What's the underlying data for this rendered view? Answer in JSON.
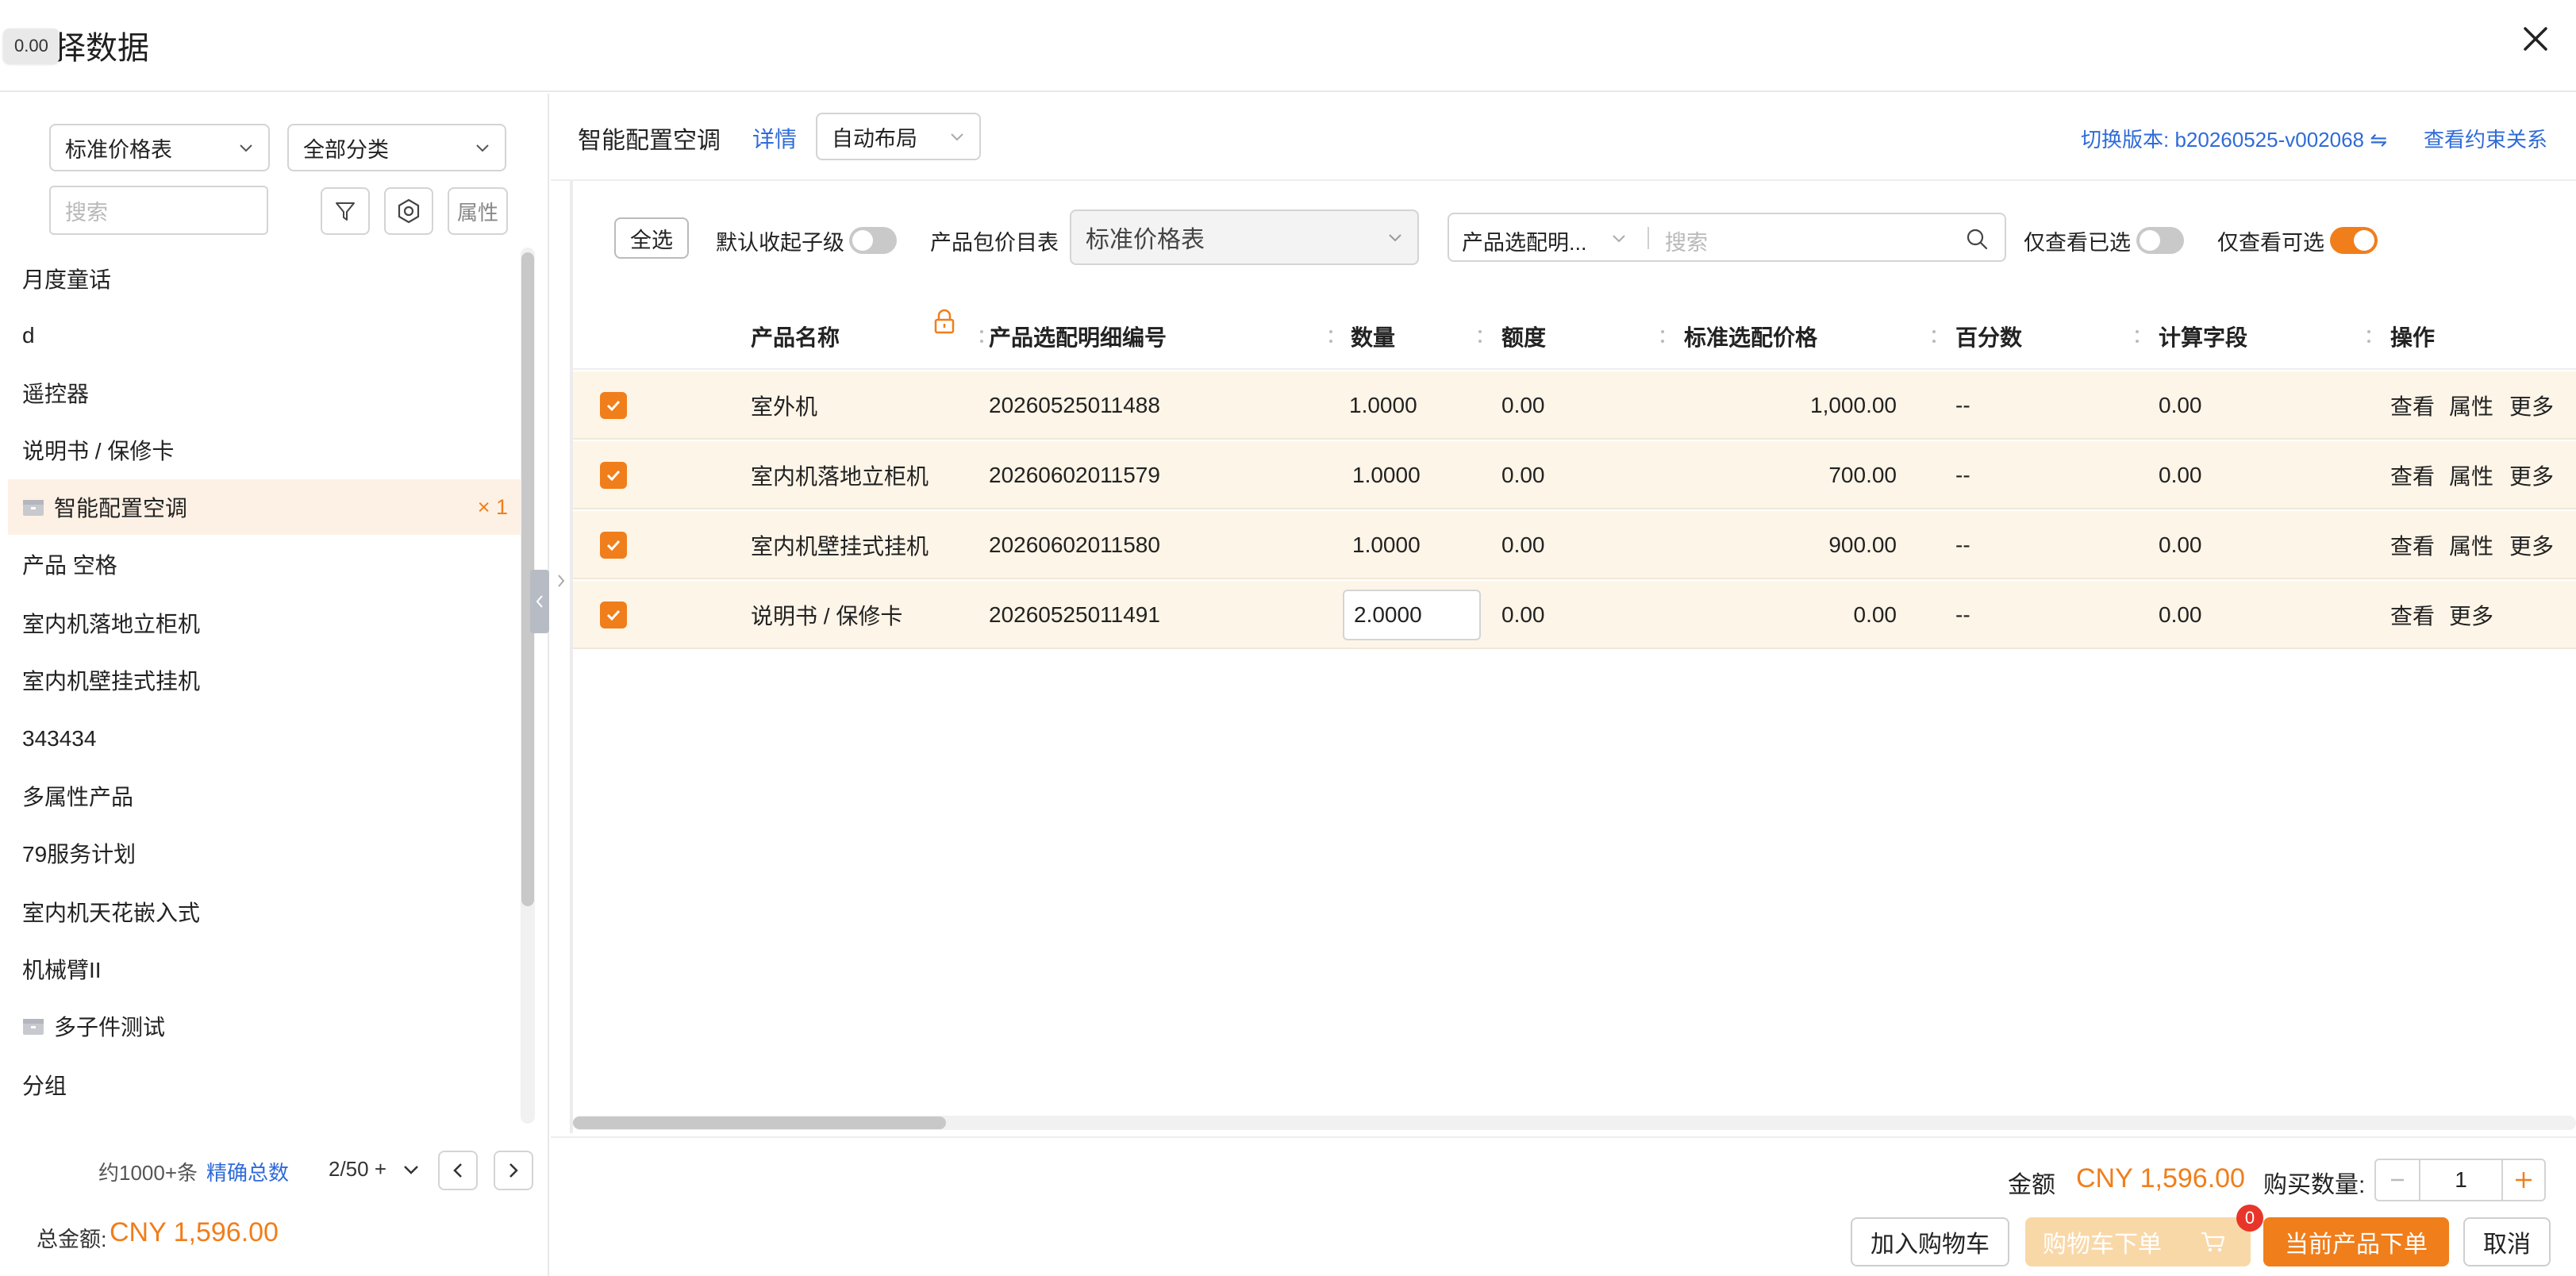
{
  "dialog": {
    "title": "选择数据",
    "tooltip": "0.00"
  },
  "left": {
    "price_list_select": "标准价格表",
    "category_select": "全部分类",
    "search_placeholder": "搜索",
    "attr_button": "属性",
    "items": [
      {
        "label": "月度童话"
      },
      {
        "label": "d"
      },
      {
        "label": "遥控器"
      },
      {
        "label": "说明书 / 保修卡"
      },
      {
        "label": "智能配置空调",
        "count": "× 1"
      },
      {
        "label": "产品 空格"
      },
      {
        "label": "室内机落地立柜机"
      },
      {
        "label": "室内机壁挂式挂机"
      },
      {
        "label": "343434"
      },
      {
        "label": "多属性产品"
      },
      {
        "label": "79服务计划"
      },
      {
        "label": "室内机天花嵌入式"
      },
      {
        "label": "机械臂II"
      },
      {
        "label": "多子件测试"
      },
      {
        "label": "分组"
      }
    ],
    "pager": {
      "approx": "约1000+条",
      "exact_total": "精确总数",
      "page": "2/50 +"
    },
    "total_label": "总金额:",
    "total_value": "CNY 1,596.00"
  },
  "right": {
    "product_title": "智能配置空调",
    "detail_link": "详情",
    "layout_select": "自动布局",
    "version_link": "切换版本: b20260525-v002068 ⇋",
    "constraint_link": "查看约束关系",
    "toolbar": {
      "select_all": "全选",
      "collapse_label": "默认收起子级",
      "price_list_label": "产品包价目表",
      "price_list_value": "标准价格表",
      "detail_field_select": "产品选配明...",
      "search_placeholder": "搜索",
      "only_selected_label": "仅查看已选",
      "only_available_label": "仅查看可选"
    },
    "columns": [
      "产品名称",
      "产品选配明细编号",
      "数量",
      "额度",
      "标准选配价格",
      "百分数",
      "计算字段",
      "操作"
    ],
    "rows": [
      {
        "name": "室外机",
        "code": "20260525011488",
        "qty": "1.0000",
        "quota": "0.00",
        "price": "1,000.00",
        "pct": "--",
        "calc": "0.00",
        "actions": [
          "查看",
          "属性",
          "更多"
        ]
      },
      {
        "name": "室内机落地立柜机",
        "code": "20260602011579",
        "qty": "1.0000",
        "quota": "0.00",
        "price": "700.00",
        "pct": "--",
        "calc": "0.00",
        "actions": [
          "查看",
          "属性",
          "更多"
        ]
      },
      {
        "name": "室内机壁挂式挂机",
        "code": "20260602011580",
        "qty": "1.0000",
        "quota": "0.00",
        "price": "900.00",
        "pct": "--",
        "calc": "0.00",
        "actions": [
          "查看",
          "属性",
          "更多"
        ]
      },
      {
        "name": "说明书 / 保修卡",
        "code": "20260525011491",
        "qty": "2.0000",
        "quota": "0.00",
        "price": "0.00",
        "pct": "--",
        "calc": "0.00",
        "actions": [
          "查看",
          "更多"
        ]
      }
    ],
    "footer": {
      "amount_label": "金额",
      "amount_value": "CNY 1,596.00",
      "qty_label": "购买数量:",
      "qty_value": "1",
      "add_cart": "加入购物车",
      "cart_order": "购物车下单",
      "cart_badge": "0",
      "current_order": "当前产品下单",
      "cancel": "取消"
    }
  },
  "colors": {
    "accent": "#f07e1b",
    "link": "#2f6bd8",
    "row_bg": "#fdf5e8"
  }
}
